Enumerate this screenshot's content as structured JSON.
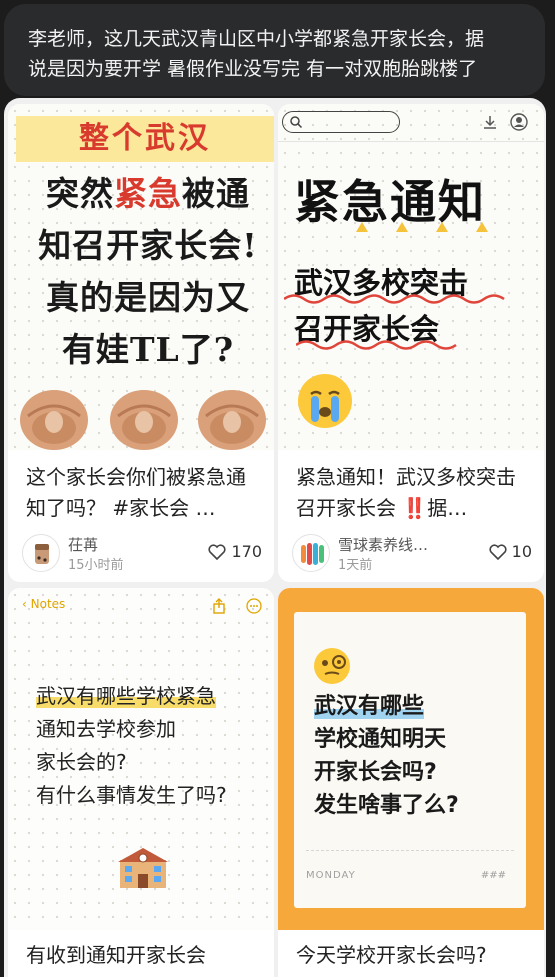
{
  "message": {
    "line1": "李老师，这几天武汉青山区中小学都紧急开家长会，据",
    "line2": "说是因为要开学 暑假作业没写完 有一对双胞胎跳楼了"
  },
  "cards": [
    {
      "image": {
        "banner": "整个武汉",
        "lines": [
          "突然",
          "紧急",
          "被通",
          "知召开家长会!",
          "真的是因为又",
          "有娃TL了?"
        ]
      },
      "title": "这个家长会你们被紧急通知了吗？ #家长会 …",
      "author": "茌苒",
      "time": "15小时前",
      "likes": "170"
    },
    {
      "image": {
        "heading": "紧急通知",
        "sub1": "武汉多校突击",
        "sub2": "召开家长会"
      },
      "title": "紧急通知！武汉多校突击召开家长会 ‼️据…",
      "author": "雪球素养线…",
      "time": "1天前",
      "likes": "10"
    },
    {
      "image": {
        "notes_back": "Notes",
        "lines": [
          "武汉有哪些学校紧急",
          "通知去学校参加",
          "家长会的?",
          "有什么事情发生了吗?"
        ]
      },
      "title": "有收到通知开家长会"
    },
    {
      "image": {
        "lines": [
          "武汉有哪些",
          "学校通知明天",
          "开家长会吗?",
          "发生啥事了么?"
        ],
        "footer_left": "MONDAY",
        "footer_right": "###"
      },
      "title": "今天学校开家长会吗?"
    }
  ],
  "colors": {
    "accent_red": "#d93a2e",
    "note_yellow": "#f8dc6a",
    "orange": "#f6a83b"
  },
  "icons": [
    "search-icon",
    "download-icon",
    "user-icon",
    "heart-icon",
    "share-icon",
    "more-icon",
    "back-chevron-icon",
    "crying-emoji-icon",
    "thinking-emoji-icon",
    "school-icon",
    "pointing-hand-icon"
  ]
}
